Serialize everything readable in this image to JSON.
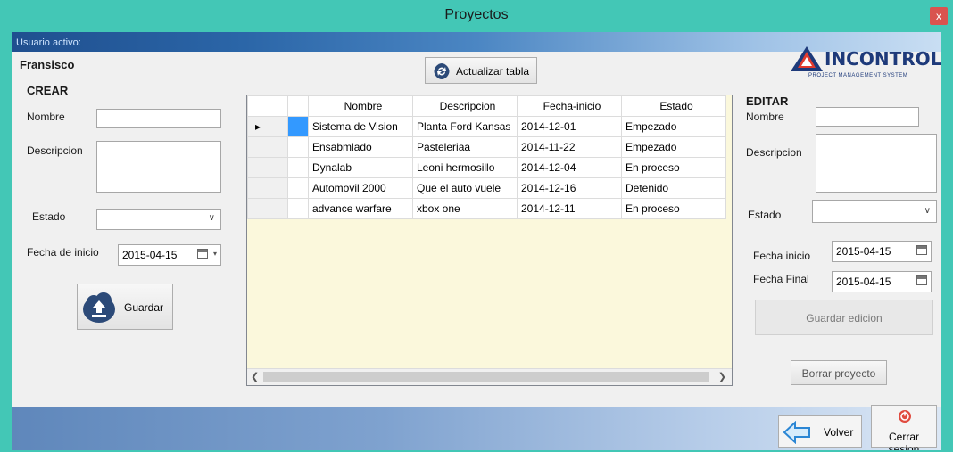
{
  "window": {
    "title": "Proyectos",
    "close_glyph": "x"
  },
  "user": {
    "label": "Usuario activo:",
    "name": "Fransisco"
  },
  "refresh_button": {
    "label": "Actualizar tabla",
    "icon": "refresh-icon"
  },
  "logo": {
    "text": "INCONTROL",
    "tagline": "PROJECT MANAGEMENT SYSTEM"
  },
  "crear": {
    "title": "CREAR",
    "nombre_label": "Nombre",
    "nombre_value": "",
    "descripcion_label": "Descripcion",
    "descripcion_value": "",
    "estado_label": "Estado",
    "estado_value": "",
    "fecha_label": "Fecha de inicio",
    "fecha_value": "2015-04-15",
    "guardar_label": "Guardar"
  },
  "table": {
    "columns": [
      "Nombre",
      "Descripcion",
      "Fecha-inicio",
      "Estado"
    ],
    "rows": [
      [
        "Sistema de Vision",
        "Planta Ford Kansas",
        "2014-12-01",
        "Empezado"
      ],
      [
        "Ensabmlado",
        "Pasteleriaa",
        "2014-11-22",
        "Empezado"
      ],
      [
        "Dynalab",
        "Leoni hermosillo",
        "2014-12-04",
        "En proceso"
      ],
      [
        "Automovil 2000",
        "Que el auto vuele",
        "2014-12-16",
        "Detenido"
      ],
      [
        "advance warfare",
        "xbox one",
        "2014-12-11",
        "En proceso"
      ]
    ],
    "current_row_marker": "▸"
  },
  "editar": {
    "title": "EDITAR",
    "nombre_label": "Nombre",
    "nombre_value": "",
    "descripcion_label": "Descripcion",
    "descripcion_value": "",
    "estado_label": "Estado",
    "estado_value": "",
    "fecha_inicio_label": "Fecha inicio",
    "fecha_inicio_value": "2015-04-15",
    "fecha_final_label": "Fecha Final",
    "fecha_final_value": "2015-04-15",
    "guardar_edicion_label": "Guardar edicion",
    "borrar_label": "Borrar proyecto"
  },
  "footer": {
    "volver_label": "Volver",
    "cerrar_label": "Cerrar sesion"
  },
  "colors": {
    "titlebar": "#43c7b6",
    "selection": "#3399ff",
    "grid_background": "#fbf8dc"
  }
}
